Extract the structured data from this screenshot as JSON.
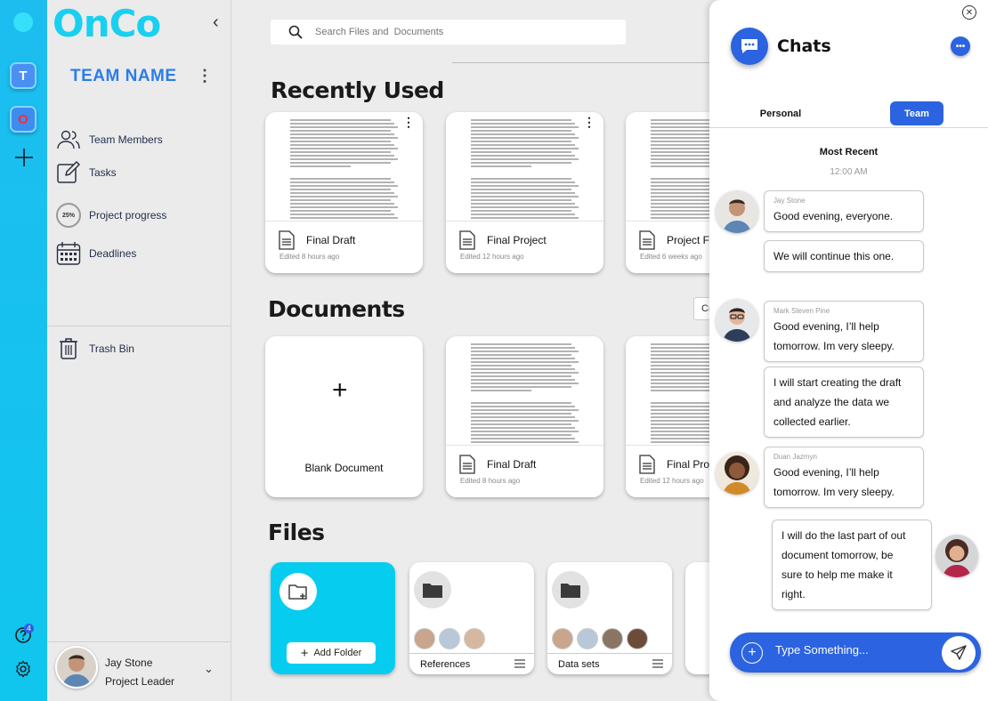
{
  "rail": {
    "team1": "T",
    "team2": "O",
    "help_badge": "4"
  },
  "sidebar": {
    "logo": "OnCo",
    "team_name": "TEAM NAME",
    "items": [
      {
        "label": "Team Members",
        "icon": "users-icon"
      },
      {
        "label": "Tasks",
        "icon": "edit-icon"
      },
      {
        "label": "Project progress",
        "icon": "progress-ring",
        "percent": "25%"
      },
      {
        "label": "Deadlines",
        "icon": "calendar-icon"
      }
    ],
    "trash": "Trash Bin",
    "profile": {
      "name": "Jay Stone",
      "role": "Project Leader"
    }
  },
  "main": {
    "search_placeholder": "Search Files and  Documents",
    "recent_title": "Recently Used",
    "recent": [
      {
        "title": "Final Draft",
        "sub": "Edited 8 hours ago"
      },
      {
        "title": "Final Project",
        "sub": "Edited 12 hours ago"
      },
      {
        "title": "Project F",
        "sub": "Edited  6 weeks ago"
      }
    ],
    "documents_title": "Documents",
    "create_label": "Cr",
    "blank_label": "Blank Document",
    "documents": [
      {
        "title": "Final Draft",
        "sub": "Edited 8 hours ago"
      },
      {
        "title": "Final Proje",
        "sub": "Edited 12 hours ago"
      }
    ],
    "files_title": "Files",
    "add_folder": "Add Folder",
    "folders": [
      {
        "name": "References"
      },
      {
        "name": "Data sets"
      }
    ]
  },
  "chat": {
    "title": "Chats",
    "tab_personal": "Personal",
    "tab_team": "Team",
    "recent": "Most Recent",
    "time": "12:00 AM",
    "messages": [
      {
        "sender": "Jay Stone",
        "lines": [
          "Good evening, everyone."
        ]
      },
      {
        "lines": [
          "We will continue this one."
        ]
      },
      {
        "sender": "Mark Steven Pine",
        "lines": [
          "Good evening, I’ll help",
          "tomorrow. Im very sleepy."
        ]
      },
      {
        "lines": [
          "I will start creating the draft",
          "and analyze the data we",
          "collected earlier."
        ]
      },
      {
        "sender": "Duan Jazmyn",
        "lines": [
          "Good evening, I’ll help",
          "tomorrow. Im very sleepy."
        ]
      },
      {
        "lines": [
          "I will do the last part of out",
          "document tomorrow, be",
          "sure to help me make it",
          "right."
        ]
      }
    ],
    "input_placeholder": "Type Something..."
  }
}
